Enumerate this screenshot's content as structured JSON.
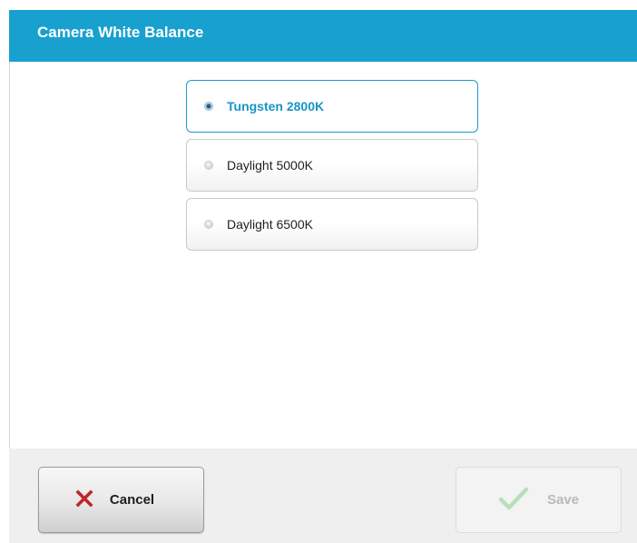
{
  "header": {
    "title": "Camera White Balance"
  },
  "options": [
    {
      "label": "Tungsten 2800K",
      "selected": true
    },
    {
      "label": "Daylight 5000K",
      "selected": false
    },
    {
      "label": "Daylight 6500K",
      "selected": false
    }
  ],
  "footer": {
    "cancel_label": "Cancel",
    "save_label": "Save",
    "save_enabled": false
  },
  "colors": {
    "accent": "#18a0cf",
    "cancel_icon": "#c0262d",
    "save_icon_disabled": "#b8e0b8"
  },
  "icons": {
    "cancel": "close-icon",
    "save": "checkmark-icon",
    "radio": "radio-icon"
  }
}
